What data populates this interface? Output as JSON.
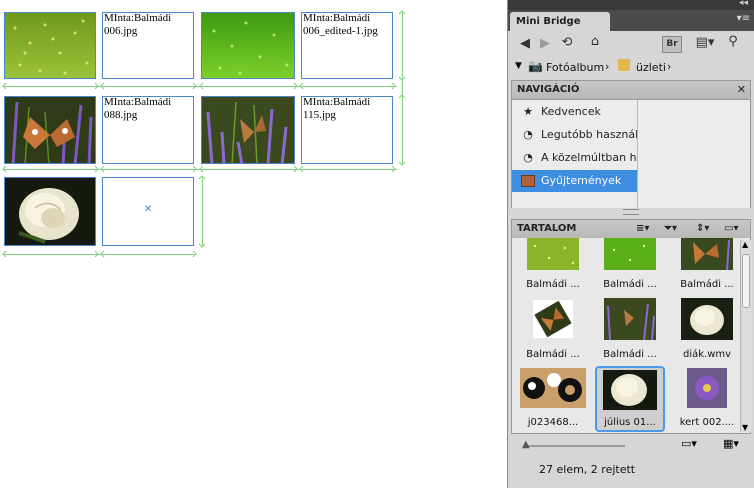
{
  "document": {
    "captions": [
      {
        "line1": "MInta:Balmádi",
        "line2": "006.jpg"
      },
      {
        "line1": "MInta:Balmádi",
        "line2": "006_edited-1.jpg"
      },
      {
        "line1": "MInta:Balmádi",
        "line2": "088.jpg"
      },
      {
        "line1": "MInta:Balmádi",
        "line2": "115.jpg"
      }
    ]
  },
  "panel": {
    "tab_title": "Mini Bridge",
    "toolbar": {
      "back_icon": "arrow-left-icon",
      "forward_icon": "arrow-right-icon",
      "recent_icon": "history-icon",
      "home_icon": "home-icon",
      "bridge_label": "Br",
      "view_icon": "panel-view-icon",
      "search_icon": "search-icon"
    },
    "path": {
      "items": [
        "Fotóalbum",
        "üzleti"
      ]
    },
    "navigation": {
      "title": "NAVIGÁCIÓ",
      "items": [
        {
          "label": "Kedvencek",
          "icon": "star-icon"
        },
        {
          "label": "Legutóbb használt",
          "icon": "recent-clock-icon"
        },
        {
          "label": "A közelmúltban has",
          "icon": "recent-clock-icon"
        },
        {
          "label": "Gyűjtemények",
          "icon": "collection-icon"
        }
      ]
    },
    "content": {
      "title": "TARTALOM",
      "thumbnails": [
        {
          "label": "Balmádi ..."
        },
        {
          "label": "Balmádi ..."
        },
        {
          "label": "Balmádi ..."
        },
        {
          "label": "Balmádi ..."
        },
        {
          "label": "Balmádi ..."
        },
        {
          "label": "diák.wmv"
        },
        {
          "label": "j023468..."
        },
        {
          "label": "július 01..."
        },
        {
          "label": "kert 002...."
        }
      ]
    },
    "status": "27 elem, 2 rejtett",
    "colors": {
      "selection": "#3d8ee0",
      "frame_border": "#4a86c8",
      "guide": "#7fd07f"
    }
  }
}
